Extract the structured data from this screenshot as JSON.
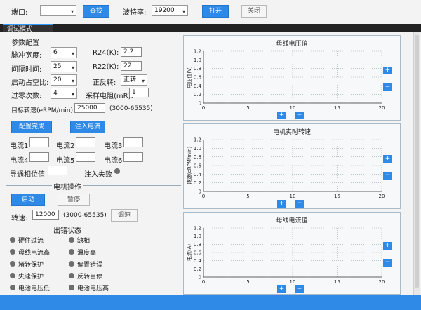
{
  "top": {
    "port_label": "端口:",
    "port_value": "",
    "search_button": "查找",
    "baud_label": "波特率:",
    "baud_value": "19200",
    "open_button": "打开",
    "close_button": "关闭"
  },
  "tab": {
    "label": "调试模式"
  },
  "params": {
    "group_title": "参数配置",
    "pulse_width_label": "脉冲宽度:",
    "pulse_width_value": "6",
    "r24_label": "R24(K):",
    "r24_value": "2.2",
    "interval_label": "间隔时间:",
    "interval_value": "25",
    "r22_label": "R22(K):",
    "r22_value": "22",
    "duty_label": "启动占空比:",
    "duty_value": "20",
    "direction_label": "正反转:",
    "direction_value": "正转",
    "zero_cross_label": "过零次数:",
    "zero_cross_value": "4",
    "sample_res_label": "采样电阻(mR):",
    "sample_res_value": "1",
    "target_speed_label": "目标转速(eRPM/min)",
    "target_speed_value": "25000",
    "target_speed_range": "(3000-65535)",
    "config_done_button": "配置完成",
    "inject_current_button": "注入电流"
  },
  "currents": {
    "c1": "电流1",
    "c2": "电流2",
    "c3": "电流3",
    "c4": "电流4",
    "c5": "电流5",
    "c6": "电流6",
    "conduct_phase_label": "导通相位值",
    "inject_fail_label": "注入失败"
  },
  "motor": {
    "group_title": "电机操作",
    "start_button": "启动",
    "pause_button": "暂停",
    "speed_label": "转速:",
    "speed_value": "12000",
    "speed_range": "(3000-65535)",
    "speed_adjust_button": "调速"
  },
  "faults": {
    "group_title": "出错状态",
    "items": [
      "硬件过流",
      "缺相",
      "母线电流高",
      "温度高",
      "堵转保护",
      "偏置错误",
      "失速保护",
      "反转自停",
      "电池电压低",
      "电池电压高"
    ]
  },
  "charts_common": {
    "plus": "+",
    "minus": "−",
    "x_ticks": [
      "0",
      "5",
      "10",
      "15",
      "20"
    ],
    "y_ticks": [
      "1.2",
      "1.0",
      "0.8",
      "0.6",
      "0.4",
      "0.2",
      "0"
    ]
  },
  "chart_data": [
    {
      "type": "line",
      "title": "母线电压值",
      "ylabel": "电压值(V)",
      "xlabel": "",
      "xlim": [
        0,
        20
      ],
      "ylim": [
        0,
        1.2
      ],
      "grid": true,
      "series": []
    },
    {
      "type": "line",
      "title": "电机实时转速",
      "ylabel": "转速(eRPM/min)",
      "xlabel": "",
      "xlim": [
        0,
        20
      ],
      "ylim": [
        0,
        1.2
      ],
      "grid": true,
      "series": []
    },
    {
      "type": "line",
      "title": "母线电流值",
      "ylabel": "电流(A)",
      "xlabel": "",
      "xlim": [
        0,
        20
      ],
      "ylim": [
        0,
        1.2
      ],
      "grid": true,
      "series": []
    }
  ],
  "colors": {
    "accent": "#2e8ae6",
    "dark": "#222222",
    "status_dot": "#6d6d6d"
  }
}
